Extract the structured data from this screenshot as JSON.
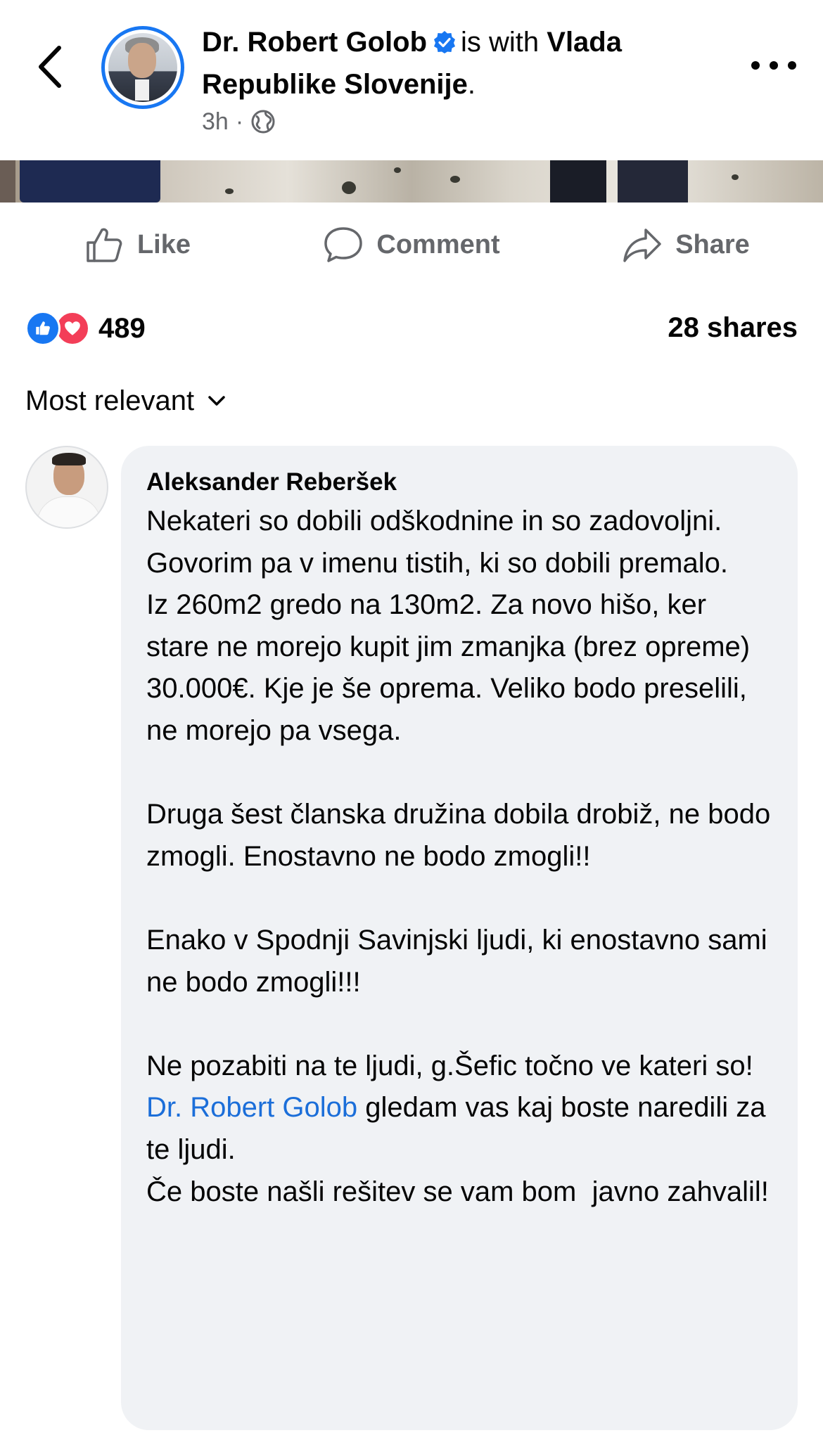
{
  "header": {
    "author": "Dr. Robert Golob",
    "with_text": "is with",
    "with_page": "Vlada Republike Slovenije",
    "period": ".",
    "time": "3h",
    "separator": "·",
    "icons": {
      "back": "chevron-left-icon",
      "verified": "verified-badge-icon",
      "audience": "globe-icon",
      "more": "more-horizontal-icon"
    }
  },
  "actions": {
    "like": "Like",
    "comment": "Comment",
    "share": "Share"
  },
  "stats": {
    "reaction_count": "489",
    "shares": "28 shares"
  },
  "sort": {
    "label": "Most relevant"
  },
  "comment": {
    "author": "Aleksander Reberšek",
    "text_before_mention": "Nekateri so dobili odškodnine in so zadovoljni.\nGovorim pa v imenu tistih, ki so dobili premalo.\nIz 260m2 gredo na 130m2. Za novo hišo, ker stare ne morejo kupit jim zmanjka (brez opreme) 30.000€. Kje je še oprema. Veliko bodo preselili, ne morejo pa vsega.\n\nDruga šest članska družina dobila drobiž, ne bodo zmogli. Enostavno ne bodo zmogli!!\n\nEnako v Spodnji Savinjski ljudi, ki enostavno sami ne bodo zmogli!!!\n\nNe pozabiti na te ljudi, g.Šefic točno ve kateri so!\n",
    "mention": "Dr. Robert Golob",
    "text_after_mention": " gledam vas kaj boste naredili za te ljudi.\nČe boste našli rešitev se vam bom  javno zahvalil!"
  },
  "colors": {
    "accent": "#1877f2",
    "mention": "#1b6ed9",
    "secondary_text": "#65676b",
    "bubble": "#f0f2f5",
    "love": "#f33e58"
  }
}
